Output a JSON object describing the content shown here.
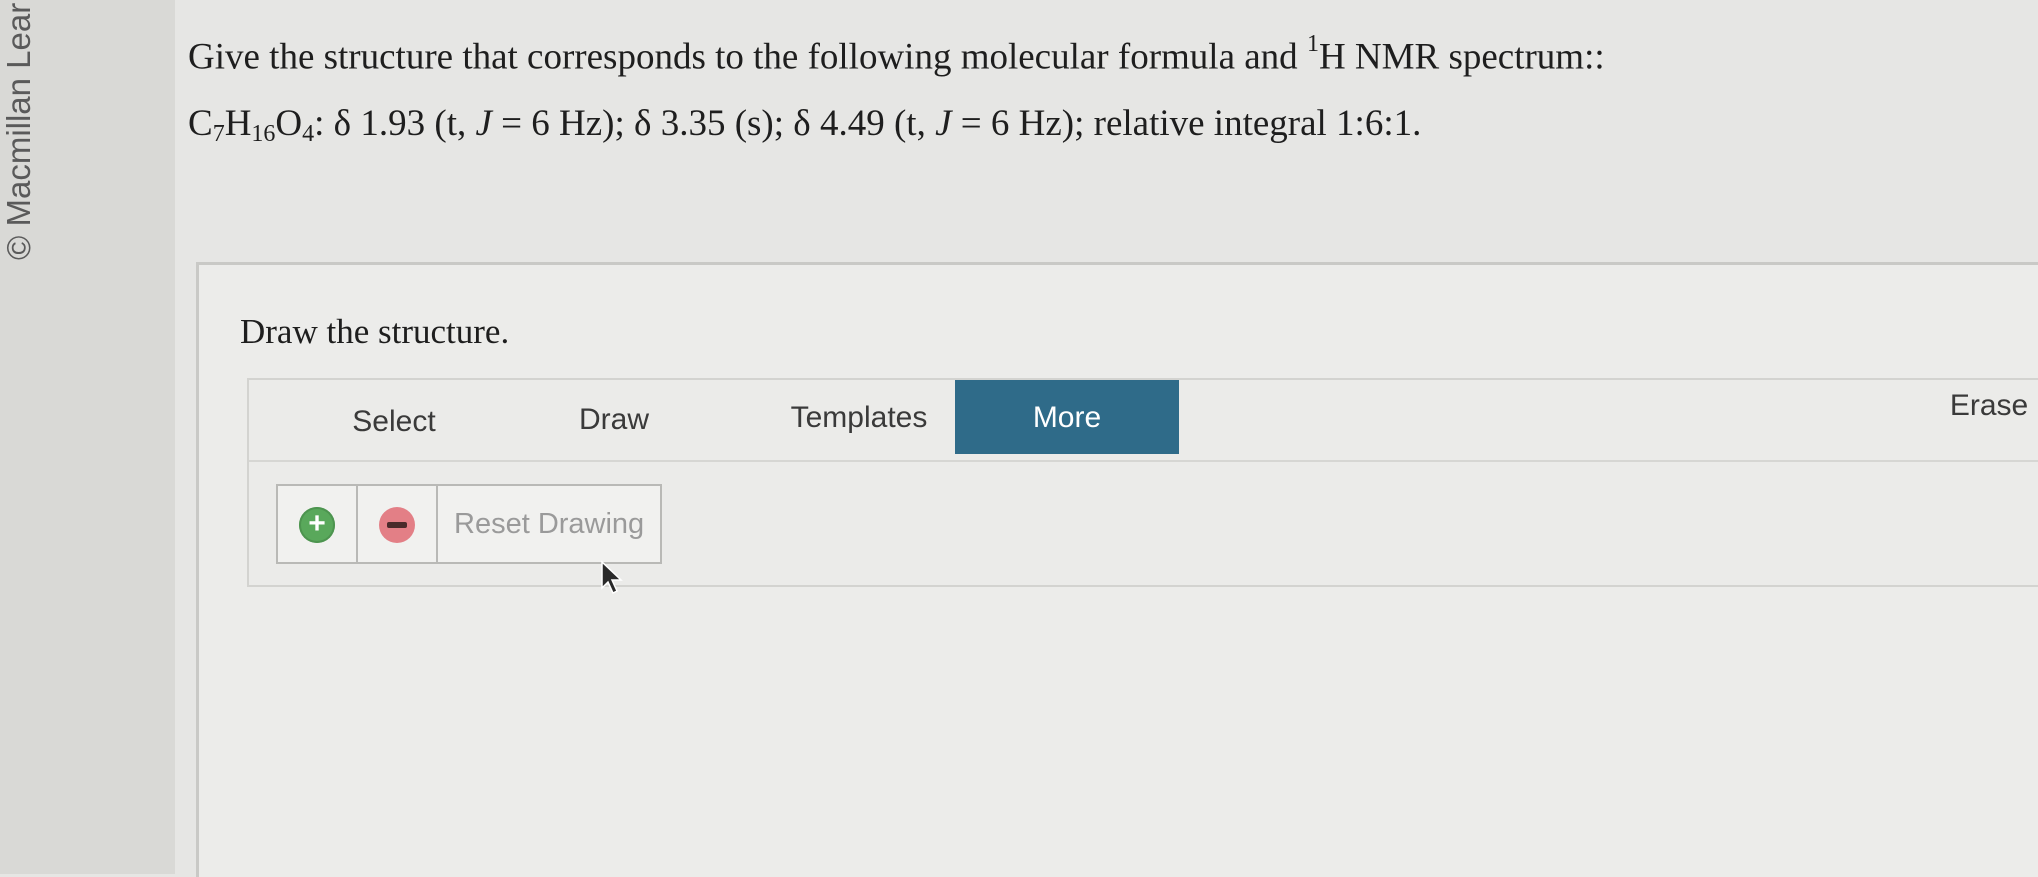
{
  "sidebar": {
    "copyright": "© Macmillan Lear"
  },
  "question": {
    "prompt": "Give the structure that corresponds to the following molecular formula and",
    "nmr_sup": "1",
    "nmr_tail": "H NMR spectrum::",
    "formula": {
      "c": "C",
      "c_sub": "7",
      "h": "H",
      "h_sub": "16",
      "o": "O",
      "o_sub": "4",
      "part1": ": δ 1.93 (t, ",
      "j1": "J",
      "part2": " = 6 Hz); δ 3.35 (s); δ 4.49 (t, ",
      "j2": "J",
      "part3": " = 6 Hz); relative integral 1:6:1."
    }
  },
  "answer": {
    "instruction": "Draw the structure."
  },
  "toolbar": {
    "select": "Select",
    "draw": "Draw",
    "templates": "Templates",
    "more": "More",
    "erase": "Erase"
  },
  "zoom": {
    "zoom_in_icon": "+",
    "reset": "Reset Drawing"
  },
  "colors": {
    "more_active": "#2f6b89",
    "zoom_in": "#59a85b",
    "zoom_out": "#e37f86"
  }
}
